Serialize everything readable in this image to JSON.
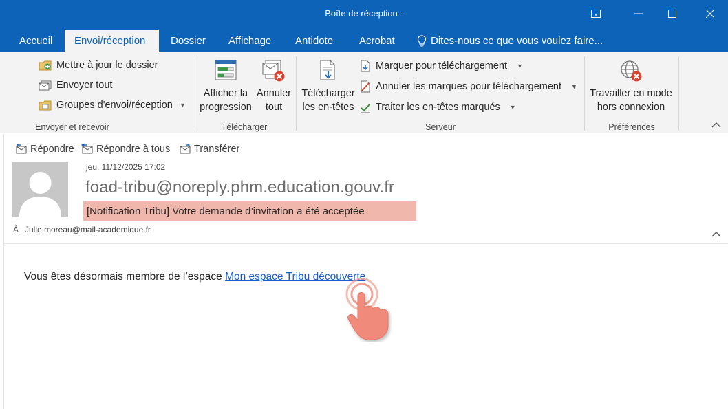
{
  "window": {
    "title": "Boîte de réception -"
  },
  "tabs": [
    {
      "label": "Accueil"
    },
    {
      "label": "Envoi/réception",
      "active": true
    },
    {
      "label": "Dossier"
    },
    {
      "label": "Affichage"
    },
    {
      "label": "Antidote"
    },
    {
      "label": "Acrobat"
    }
  ],
  "tellme": {
    "label": "Dites-nous ce que vous voulez faire...",
    "icon": "lightbulb-icon"
  },
  "ribbon": {
    "send_receive": {
      "label": "Envoyer et recevoir",
      "update_folder": "Mettre à jour le dossier",
      "send_all": "Envoyer tout",
      "groups": "Groupes d'envoi/réception"
    },
    "download": {
      "label": "Télécharger",
      "show_progress_1": "Afficher la",
      "show_progress_2": "progression",
      "cancel_all_1": "Annuler",
      "cancel_all_2": "tout"
    },
    "server": {
      "label": "Serveur",
      "download_headers_1": "Télécharger",
      "download_headers_2": "les en-têtes",
      "mark_download": "Marquer pour téléchargement",
      "unmark_download": "Annuler les marques pour téléchargement",
      "process_headers": "Traiter les en-têtes marqués"
    },
    "preferences": {
      "label": "Préférences",
      "offline_1": "Travailler en mode",
      "offline_2": "hors connexion"
    }
  },
  "email": {
    "actions": {
      "reply": "Répondre",
      "reply_all": "Répondre à tous",
      "forward": "Transférer"
    },
    "date": "jeu. 11/12/2025 17:02",
    "sender": "foad-tribu@noreply.phm.education.gouv.fr",
    "subject": "[Notification Tribu] Votre demande d’invitation a été acceptée",
    "to_label": "À",
    "to": "Julie.moreau@mail-academique.fr",
    "body_prefix": "Vous êtes désormais membre de l’espace ",
    "body_link": "Mon espace Tribu découverte",
    "body_suffix": "."
  },
  "colors": {
    "titlebar": "#0c63b8",
    "ribbon": "#f3f3f3",
    "subject_highlight": "#f0b8ad",
    "link": "#1a5cc9",
    "cursor": "#f08a7a"
  }
}
